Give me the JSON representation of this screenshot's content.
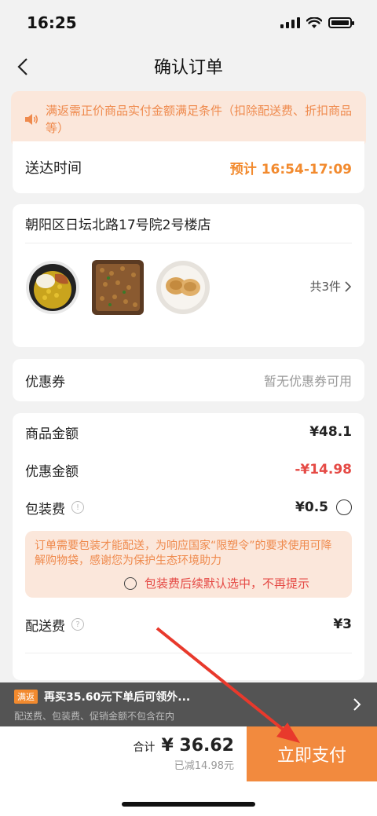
{
  "status_bar": {
    "time": "16:25"
  },
  "nav": {
    "title": "确认订单"
  },
  "notice": {
    "text": "满返需正价商品实付金额满足条件（扣除配送费、折扣商品等）"
  },
  "delivery": {
    "label": "送达时间",
    "value": "预计 16:54-17:09"
  },
  "store": {
    "name": "朝阳区日坛北路17号院2号楼店",
    "product_count": "共3件",
    "products": [
      "rice-bowl-dish",
      "tray-dish",
      "dumplings-plate"
    ]
  },
  "coupon": {
    "label": "优惠券",
    "value": "暂无优惠券可用"
  },
  "prices": {
    "goods_label": "商品金额",
    "goods_value": "¥48.1",
    "discount_label": "优惠金额",
    "discount_value": "-¥14.98",
    "package_label": "包装费",
    "package_value": "¥0.5",
    "delivery_label": "配送费",
    "delivery_value": "¥3"
  },
  "package_notice": {
    "text": "订单需要包装才能配送，为响应国家“限塑令”的要求使用可降解购物袋，感谢您为保护生态环境助力",
    "option": "包装费后续默认选中，不再提示"
  },
  "promo": {
    "badge": "满返",
    "title": "再买35.60元下单后可领外...",
    "subtitle": "配送费、包装费、促销金额不包含在内"
  },
  "footer": {
    "total_label": "合计",
    "total_amount": "¥ 36.62",
    "saved": "已减14.98元",
    "pay_label": "立即支付"
  },
  "colors": {
    "accent": "#f28a3e",
    "red": "#e54a45",
    "notice_bg": "#fbe7db"
  }
}
